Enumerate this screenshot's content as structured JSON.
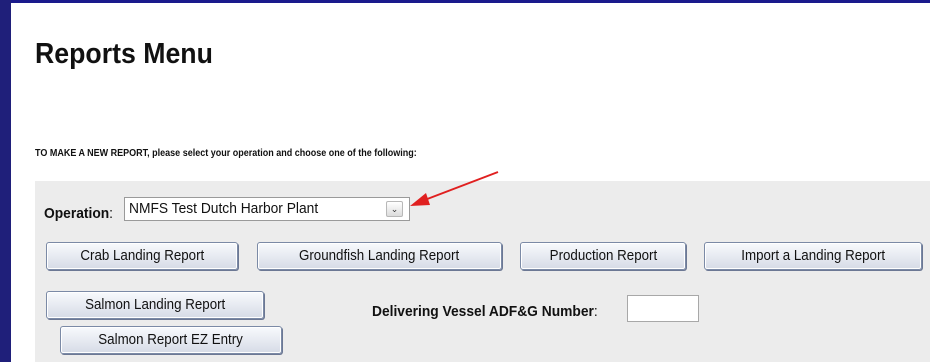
{
  "page": {
    "title": "Reports Menu",
    "instructions": "TO MAKE A NEW REPORT, please select your operation and choose one of the following:"
  },
  "operation": {
    "label": "Operation",
    "colon": ":",
    "selected": "NMFS Test Dutch Harbor Plant",
    "dropdown_icon": "chevron-down-icon"
  },
  "buttons": {
    "crab": "Crab Landing Report",
    "groundfish": "Groundfish Landing Report",
    "production": "Production Report",
    "import": "Import a Landing Report",
    "salmon": "Salmon Landing Report",
    "salmon_ez": "Salmon Report EZ Entry"
  },
  "vessel": {
    "label": "Delivering Vessel ADF&G Number",
    "colon": ":",
    "value": ""
  },
  "colors": {
    "accent_bar": "#1f1f7a",
    "annotation_arrow": "#e02020",
    "panel_bg": "#ececec"
  }
}
